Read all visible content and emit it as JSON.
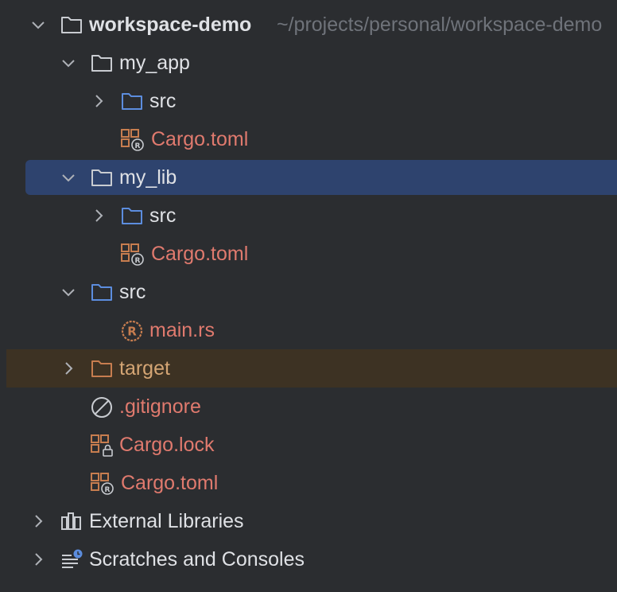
{
  "project": {
    "name": "workspace-demo",
    "path": "~/projects/personal/workspace-demo"
  },
  "tree": {
    "my_app": {
      "label": "my_app",
      "src": "src",
      "cargo": "Cargo.toml"
    },
    "my_lib": {
      "label": "my_lib",
      "src": "src",
      "cargo": "Cargo.toml"
    },
    "src": {
      "label": "src",
      "main": "main.rs"
    },
    "target": {
      "label": "target"
    },
    "gitignore": {
      "label": ".gitignore"
    },
    "cargo_lock": {
      "label": "Cargo.lock"
    },
    "cargo_toml": {
      "label": "Cargo.toml"
    }
  },
  "bottom": {
    "external": "External Libraries",
    "scratches": "Scratches and Consoles"
  },
  "colors": {
    "background": "#2b2d30",
    "selection": "#2e436e",
    "excluded": "#3d3223",
    "modified_text": "#e07a6e",
    "folder_blue": "#5c8dde",
    "cargo_orange": "#c77d4f"
  }
}
